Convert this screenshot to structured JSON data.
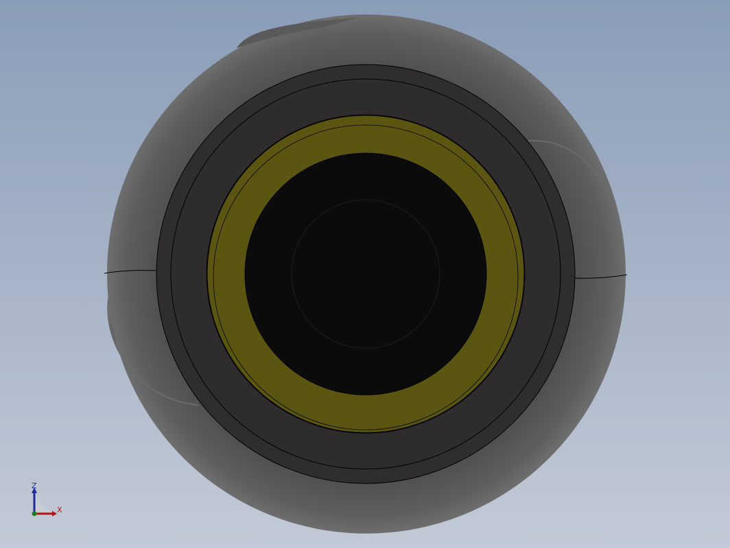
{
  "viewport": {
    "background_top": "#8a9db8",
    "background_bottom": "#c3cad6"
  },
  "model": {
    "body_color": "#4f4f4f",
    "housing_color": "#2e2d2d",
    "bushing_color": "#5a5511",
    "bore_color": "#0b0b0b",
    "edge_color": "#000000"
  },
  "triad": {
    "z_label": "Z",
    "x_label": "X",
    "z_color": "#1a2a9a",
    "x_color": "#b01515",
    "origin_color": "#1d7a1d"
  }
}
